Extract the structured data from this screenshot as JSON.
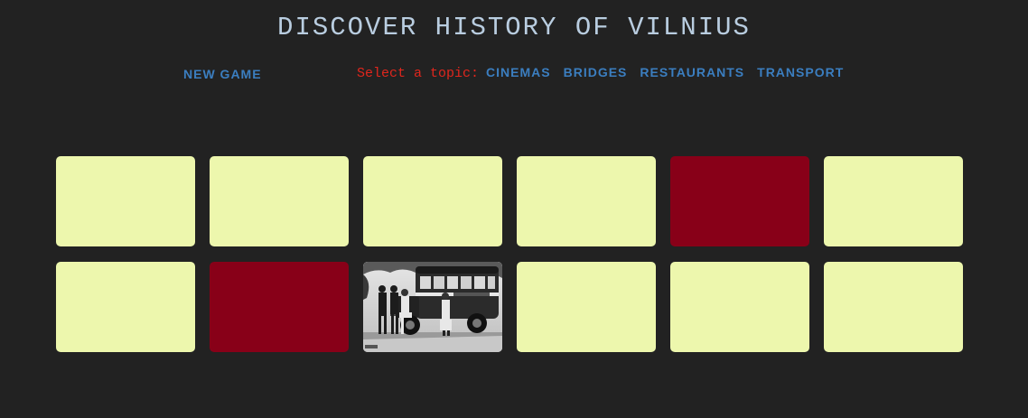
{
  "header": {
    "title": "DISCOVER HISTORY OF VILNIUS"
  },
  "controls": {
    "new_game_label": "NEW GAME",
    "topic_prompt": "Select a topic:",
    "topics": [
      "CINEMAS",
      "BRIDGES",
      "RESTAURANTS",
      "TRANSPORT"
    ]
  },
  "board": {
    "rows": 2,
    "columns": 6,
    "cards": [
      {
        "state": "face-down"
      },
      {
        "state": "face-down"
      },
      {
        "state": "face-down"
      },
      {
        "state": "face-down"
      },
      {
        "state": "matched"
      },
      {
        "state": "face-down"
      },
      {
        "state": "face-down"
      },
      {
        "state": "matched"
      },
      {
        "state": "revealed",
        "image": "vintage-bus-photo"
      },
      {
        "state": "face-down"
      },
      {
        "state": "face-down"
      },
      {
        "state": "face-down"
      }
    ]
  },
  "colors": {
    "background": "#222222",
    "title": "#b9cde0",
    "link": "#3b7ec0",
    "prompt": "#e0261d",
    "card_back": "#edf7ad",
    "card_matched": "#880018"
  }
}
